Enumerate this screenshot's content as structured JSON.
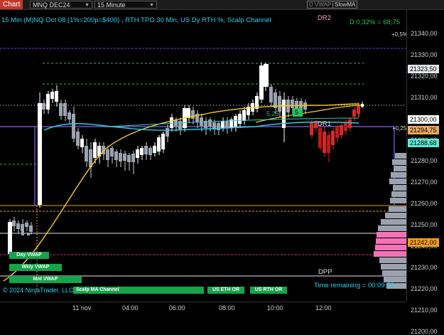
{
  "toolbar": {
    "chart_label": "Chart",
    "instrument": "MNQ DEC24",
    "interval": "15 Minute",
    "buttons": [
      "D VWAP",
      "SlowMA"
    ]
  },
  "chart": {
    "title": "15 Min (M)NQ Oct 08 (1%=200p=$400) , RTH TPO 30 Min, US Dy RTH %, Scalp Channel",
    "d_label": "D 0,32% = 68,75",
    "pct_label_top": "+0,5%",
    "pct_label_mid": "+0,25",
    "labels": {
      "dr2": "DR2",
      "dr1": "DR1",
      "dpp": "DPP",
      "range_value": "5,25",
      "green_box": "5"
    },
    "pills": {
      "day_vwap": "Day VWAP",
      "wkly_vwap": "Wkly VWAP",
      "mnt_vwap": "Mnt VWAP",
      "scalp_ma": "Scalp MA Channel",
      "us_eth_or": "US ETH OR",
      "us_rth_or": "US RTH OR"
    },
    "copyright": "© 2024 NinjaTrader, LLC",
    "time_remaining": "Time remaining = 00:09:58"
  },
  "price_axis": {
    "ticks": [
      "21340,00",
      "21330,00",
      "21320,00",
      "21310,00",
      "21300,00",
      "21290,00",
      "21280,00",
      "21270,00",
      "21260,00",
      "21250,00",
      "21240,00",
      "21230,00",
      "21220,00",
      "21210,00",
      "21200,00"
    ],
    "tags": [
      {
        "value": "21323,50",
        "color": "#e5e7eb"
      },
      {
        "value": "21300,00",
        "color": "#ffffff"
      },
      {
        "value": "21294,75",
        "color": "#e8a860"
      },
      {
        "value": "21288,68",
        "color": "#5eead4"
      },
      {
        "value": "21242,00",
        "color": "#f59e0b"
      }
    ]
  },
  "time_axis": {
    "ticks": [
      "11 nov",
      "04:00",
      "06:00",
      "08:00",
      "10:00",
      "12:00"
    ]
  },
  "colors": {
    "up": "#ffffff",
    "down": "#9ca3af",
    "bear_red": "#dc2626",
    "sma_yellow": "#facc15",
    "vwap_cyan": "#22d3ee",
    "or_purple": "#8b5cf6",
    "profile_gray": "#9ca3af",
    "profile_pink": "#f472b6"
  }
}
